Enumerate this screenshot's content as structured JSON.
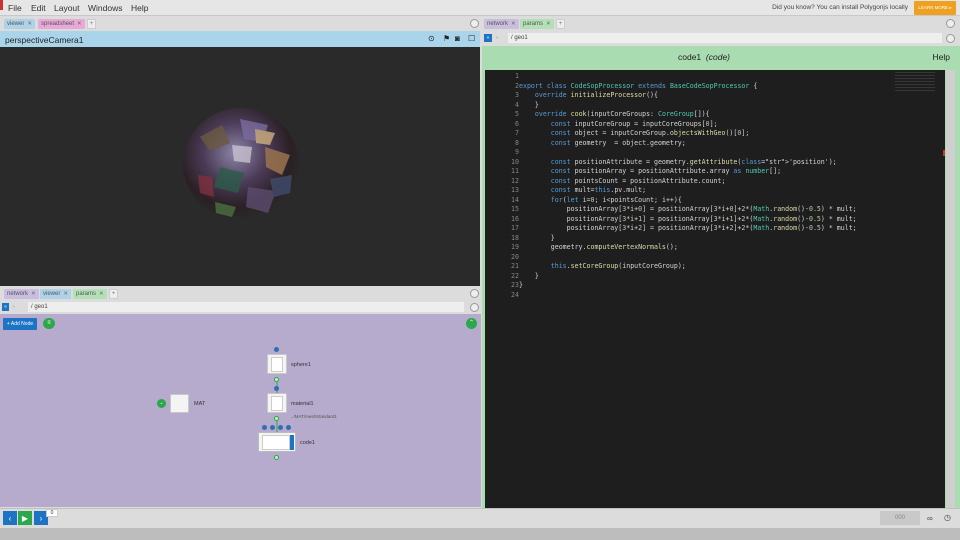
{
  "menu": [
    "File",
    "Edit",
    "Layout",
    "Windows",
    "Help"
  ],
  "banner": {
    "tip": "Did you know? You can install Polygonjs locally",
    "learn_more": "LEARN MORE ▸"
  },
  "left_tabs": [
    {
      "label": "viewer",
      "kind": "viewer"
    },
    {
      "label": "spreadsheet",
      "kind": "spreadsheet"
    }
  ],
  "viewer": {
    "title": "perspectiveCamera1"
  },
  "net_tabs": [
    {
      "label": "network",
      "kind": "network"
    },
    {
      "label": "viewer",
      "kind": "viewer"
    },
    {
      "label": "params",
      "kind": "params"
    }
  ],
  "network": {
    "path": "/ geo1",
    "add_node": "+ Add Node",
    "nodes": [
      {
        "name": "sphere1"
      },
      {
        "name": "material1",
        "sublabel": "../MAT/meshStandard1"
      },
      {
        "name": "code1"
      },
      {
        "name": "MAT"
      }
    ]
  },
  "right_tabs": [
    {
      "label": "network",
      "kind": "network"
    },
    {
      "label": "params",
      "kind": "params"
    }
  ],
  "params": {
    "path": "/ geo1",
    "title": "code1",
    "subtitle": "(code)",
    "help": "Help"
  },
  "code_lines": [
    "",
    "export class CodeSopProcessor extends BaseCodeSopProcessor {",
    "    override initializeProcessor(){",
    "    }",
    "    override cook(inputCoreGroups: CoreGroup[]){",
    "        const inputCoreGroup = inputCoreGroups[0];",
    "        const object = inputCoreGroup.objectsWithGeo()[0];",
    "        const geometry  = object.geometry;",
    "",
    "        const positionAttribute = geometry.getAttribute('position');",
    "        const positionArray = positionAttribute.array as number[];",
    "        const pointsCount = positionAttribute.count;",
    "        const mult=this.pv.mult;",
    "        for(let i=0; i<pointsCount; i++){",
    "            positionArray[3*i+0] = positionArray[3*i+0]+2*(Math.random()-0.5) * mult;",
    "            positionArray[3*i+1] = positionArray[3*i+1]+2*(Math.random()-0.5) * mult;",
    "            positionArray[3*i+2] = positionArray[3*i+2]+2*(Math.random()-0.5) * mult;",
    "        }",
    "        geometry.computeVertexNormals();",
    "",
    "        this.setCoreGroup(inputCoreGroup);",
    "    }",
    "}",
    ""
  ],
  "timeline": {
    "frame": "0",
    "fps": "000"
  },
  "colors": {
    "accent": "#1d73c4",
    "play": "#2aa84a",
    "params_header": "#a9dcb0",
    "viewer_header": "#a9d4ea",
    "network_bg": "#b6abcc"
  }
}
